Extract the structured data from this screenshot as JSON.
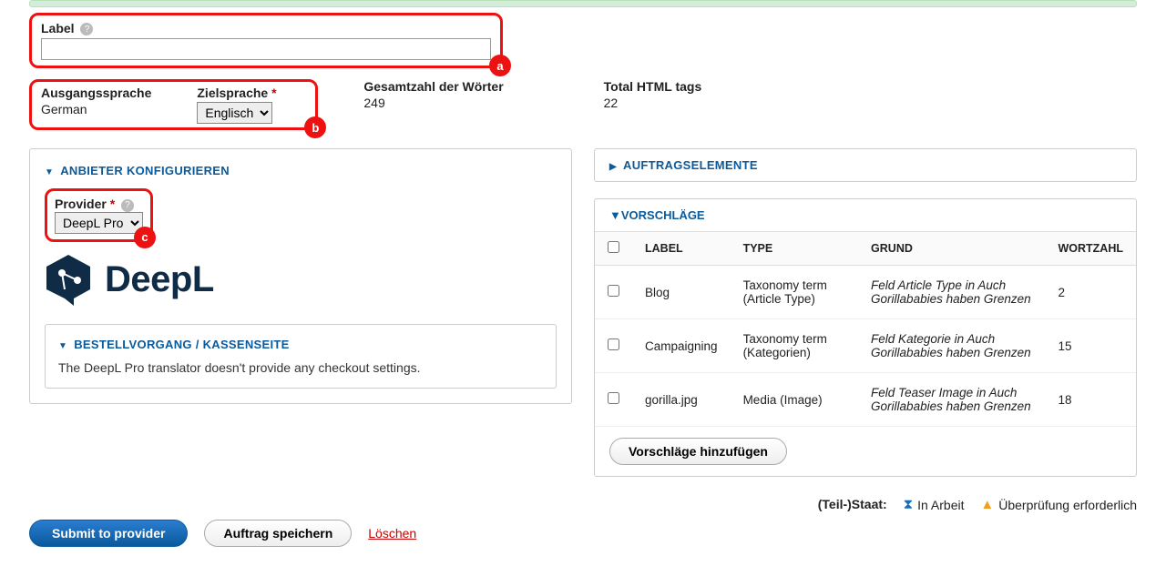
{
  "label_field": {
    "label": "Label",
    "value": ""
  },
  "langs": {
    "source_label": "Ausgangssprache",
    "source_value": "German",
    "target_label": "Zielsprache",
    "target_selected": "Englisch"
  },
  "word_count": {
    "label": "Gesamtzahl der Wörter",
    "value": "249"
  },
  "html_tags": {
    "label": "Total HTML tags",
    "value": "22"
  },
  "configure_provider": {
    "title": "ANBIETER KONFIGURIEREN",
    "provider_label": "Provider",
    "provider_selected": "DeepL Pro",
    "logo_text": "DeepL",
    "checkout_title": "BESTELLVORGANG / KASSENSEITE",
    "checkout_body": "The DeepL Pro translator doesn't provide any checkout settings."
  },
  "job_items": {
    "title": "AUFTRAGSELEMENTE"
  },
  "suggestions": {
    "title": "VORSCHLÄGE",
    "headers": {
      "label": "LABEL",
      "type": "TYPE",
      "reason": "GRUND",
      "wordcount": "WORTZAHL"
    },
    "rows": [
      {
        "label": "Blog",
        "type": "Taxonomy term (Article Type)",
        "reason": "Feld Article Type in Auch Gorillababies haben Grenzen",
        "wc": "2"
      },
      {
        "label": "Campaigning",
        "type": "Taxonomy term (Kategorien)",
        "reason": "Feld Kategorie in Auch Gorillababies haben Grenzen",
        "wc": "15"
      },
      {
        "label": "gorilla.jpg",
        "type": "Media (Image)",
        "reason": "Feld Teaser Image in Auch Gorillababies haben Grenzen",
        "wc": "18"
      }
    ],
    "add_btn": "Vorschläge hinzufügen"
  },
  "status": {
    "label": "(Teil-)Staat:",
    "in_progress": "In Arbeit",
    "review": "Überprüfung erforderlich"
  },
  "actions": {
    "submit": "Submit to provider",
    "save": "Auftrag speichern",
    "delete": "Löschen"
  },
  "annotations": {
    "a": "a",
    "b": "b",
    "c": "c"
  }
}
